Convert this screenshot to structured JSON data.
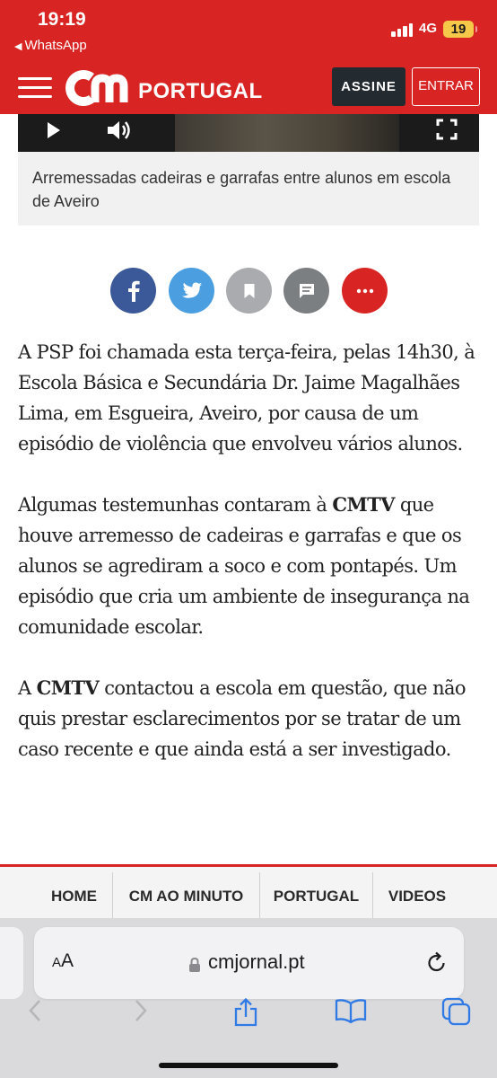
{
  "status_bar": {
    "time": "19:19",
    "back_app": "WhatsApp",
    "network": "4G",
    "battery": "19"
  },
  "header": {
    "logo": "cm",
    "section": "PORTUGAL",
    "subscribe_label": "ASSINE",
    "login_label": "ENTRAR",
    "brand_color": "#d82523"
  },
  "video": {
    "caption": "Arremessadas cadeiras e garrafas entre alunos em escola de Aveiro",
    "controls": [
      "play-icon",
      "volume-icon",
      "fullscreen-icon"
    ]
  },
  "share": {
    "buttons": [
      {
        "name": "facebook",
        "color": "#3b5998"
      },
      {
        "name": "twitter",
        "color": "#4b9fe0"
      },
      {
        "name": "bookmark",
        "color": "#a9abae"
      },
      {
        "name": "comments",
        "color": "#7c7f82"
      },
      {
        "name": "more",
        "color": "#d82523"
      }
    ]
  },
  "article": {
    "p1": "A PSP foi chamada esta terça-feira, pelas 14h30, à Escola Básica e Secundária Dr. Jaime Magalhães Lima, em Esgueira, Aveiro, por causa de um episódio de violência que envolveu vários alunos.",
    "p2_a": "Algumas testemunhas contaram à ",
    "p2_bold": "CMTV",
    "p2_b": " que houve arremesso de cadeiras e garrafas e que os alunos se agrediram a soco e com pontapés. Um episódio que cria um ambiente de insegurança na comunidade escolar.",
    "p3_a": "A ",
    "p3_bold": "CMTV",
    "p3_b": " contactou a escola em questão, que não quis prestar esclarecimentos por se tratar de um caso recente e que ainda está a ser investigado."
  },
  "bottom_nav": {
    "items": [
      "HOME",
      "CM AO MINUTO",
      "PORTUGAL",
      "VIDEOS"
    ]
  },
  "browser": {
    "aa_small": "A",
    "aa_big": "A",
    "url": "cmjornal.pt",
    "toolbar": [
      "back-icon",
      "forward-icon",
      "share-icon",
      "bookmarks-icon",
      "tabs-icon"
    ]
  }
}
